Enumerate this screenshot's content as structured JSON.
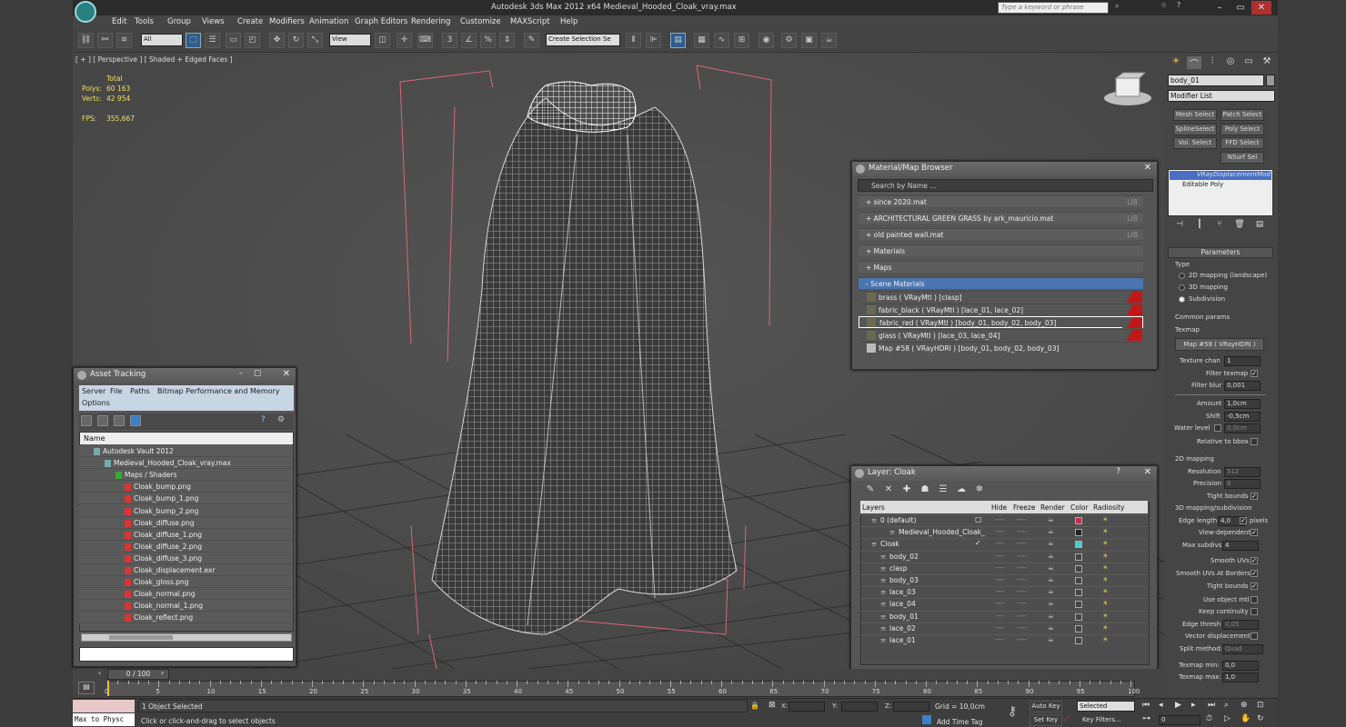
{
  "app": {
    "title": "Autodesk 3ds Max  2012 x64     Medieval_Hooded_Cloak_vray.max",
    "search_placeholder": "Type a keyword or phrase"
  },
  "menu": [
    "Edit",
    "Tools",
    "Group",
    "Views",
    "Create",
    "Modifiers",
    "Animation",
    "Graph Editors",
    "Rendering",
    "Customize",
    "MAXScript",
    "Help"
  ],
  "toolbar": {
    "selection_filter": "All",
    "ref_coord": "View",
    "named_selection": "Create Selection Se"
  },
  "viewport": {
    "label": "[ + ] [ Perspective ] [ Shaded + Edged Faces ]",
    "stats": {
      "total_label": "Total",
      "polys_label": "Polys:",
      "polys": "60 163",
      "verts_label": "Verts:",
      "verts": "42 954",
      "fps_label": "FPS:",
      "fps": "355,667"
    }
  },
  "material_browser": {
    "title": "Material/Map Browser",
    "search_placeholder": "Search by Name ...",
    "libraries": [
      {
        "label": "+ since 2020.mat",
        "tag": "LIB"
      },
      {
        "label": "+ ARCHITECTURAL GREEN GRASS by ark_mauricio.mat",
        "tag": "LIB"
      },
      {
        "label": "+ old painted wall.mat",
        "tag": "LIB"
      }
    ],
    "groups": [
      "+ Materials",
      "+ Maps"
    ],
    "scene_header": "- Scene Materials",
    "scene_items": [
      "brass  ( VRayMtl ) [clasp]",
      "fabric_black  ( VRayMtl ) [lace_01, lace_02]",
      "fabric_red  ( VRayMtl ) [body_01, body_02, body_03]",
      "glass  ( VRayMtl ) [lace_03, lace_04]",
      "Map #58  ( VRayHDRI ) [body_01, body_02, body_03]"
    ]
  },
  "asset_tracking": {
    "title": "Asset Tracking",
    "menu": [
      "Server",
      "File",
      "Paths",
      "Bitmap Performance and Memory"
    ],
    "menu2": "Options",
    "column": "Name",
    "tree": [
      "Autodesk Vault 2012",
      "Medieval_Hooded_Cloak_vray.max",
      "Maps / Shaders",
      "Cloak_bump.png",
      "Cloak_bump_1.png",
      "Cloak_bump_2.png",
      "Cloak_diffuse.png",
      "Cloak_diffuse_1.png",
      "Cloak_diffuse_2.png",
      "Cloak_diffuse_3.png",
      "Cloak_displacement.exr",
      "Cloak_gloss.png",
      "Cloak_normal.png",
      "Cloak_normal_1.png",
      "Cloak_reflect.png"
    ]
  },
  "layer_manager": {
    "title": "Layer: Cloak",
    "columns": [
      "Layers",
      "Hide",
      "Freeze",
      "Render",
      "Color",
      "Radiosity"
    ],
    "rows": [
      {
        "name": "0 (default)",
        "indent": 0
      },
      {
        "name": "Medieval_Hooded_Cloak_",
        "indent": 2
      },
      {
        "name": "Cloak",
        "indent": 0
      },
      {
        "name": "body_02",
        "indent": 1
      },
      {
        "name": "clasp",
        "indent": 1
      },
      {
        "name": "body_03",
        "indent": 1
      },
      {
        "name": "lace_03",
        "indent": 1
      },
      {
        "name": "lace_04",
        "indent": 1
      },
      {
        "name": "body_01",
        "indent": 1
      },
      {
        "name": "lace_02",
        "indent": 1
      },
      {
        "name": "lace_01",
        "indent": 1
      }
    ]
  },
  "command_panel": {
    "object_name": "body_01",
    "modifier_list": "Modifier List",
    "buttons": [
      "Mesh Select",
      "Patch Select",
      "SplineSelect",
      "Poly Select",
      "Vol. Select",
      "FFD Select",
      "NSurf Sel"
    ],
    "stack": [
      "VRayDisplacementMod",
      "Editable Poly"
    ],
    "rollout": "Parameters",
    "type_label": "Type",
    "types": [
      "2D mapping (landscape)",
      "3D mapping",
      "Subdivision"
    ],
    "common": "Common params",
    "texmap_label": "Texmap",
    "texmap": "Map #58  ( VRayHDRI )",
    "params": [
      {
        "label": "Texture chan",
        "value": "1"
      },
      {
        "label": "Filter texmap",
        "value": ""
      },
      {
        "label": "Filter blur",
        "value": "0,001"
      },
      {
        "label": "Amount",
        "value": "1,0cm"
      },
      {
        "label": "Shift",
        "value": "-0,5cm"
      },
      {
        "label": "Water level",
        "value": "0,0cm"
      },
      {
        "label": "Relative to bbox",
        "value": ""
      }
    ],
    "mapping2d": "2D mapping",
    "resolution_label": "Resolution",
    "resolution": "512",
    "precision_label": "Precision",
    "precision": "8",
    "tight_bounds": "Tight bounds",
    "mapping3d": "3D mapping/subdivision",
    "edge_length_label": "Edge length",
    "edge_length": "4,0",
    "pixels": "pixels",
    "view_dependent": "View-dependent",
    "max_subdivs_label": "Max subdivs",
    "max_subdivs": "4",
    "smooth_uvs": "Smooth UVs",
    "smooth_uvs_borders": "Smooth UVs At Borders",
    "tight_bounds2": "Tight bounds",
    "use_object_mtl": "Use object mtl",
    "keep_continuity": "Keep continuity",
    "edge_thresh_label": "Edge thresh",
    "edge_thresh": "0,05",
    "vector_disp": "Vector displacement",
    "split_method_label": "Split method:",
    "split_method": "Quad",
    "texmap_min_label": "Texmap min:",
    "texmap_min": "0,0",
    "texmap_max_label": "Texmap max:",
    "texmap_max": "1,0"
  },
  "timeline": {
    "frame": "0 / 100",
    "ticks": [
      "0",
      "5",
      "10",
      "15",
      "20",
      "25",
      "30",
      "35",
      "40",
      "45",
      "50",
      "55",
      "60",
      "65",
      "70",
      "75",
      "80",
      "85",
      "90",
      "95",
      "100"
    ]
  },
  "status": {
    "maxscript": "Max to Physc",
    "selected": "1 Object Selected",
    "prompt": "Click or click-and-drag to select objects",
    "x_label": "X:",
    "y_label": "Y:",
    "z_label": "Z:",
    "grid": "Grid = 10,0cm",
    "autokey": "Auto Key",
    "setkey": "Set Key",
    "selected_combo": "Selected",
    "add_time_tag": "Add Time Tag",
    "key_filters": "Key Filters...",
    "frame_val": "0"
  }
}
